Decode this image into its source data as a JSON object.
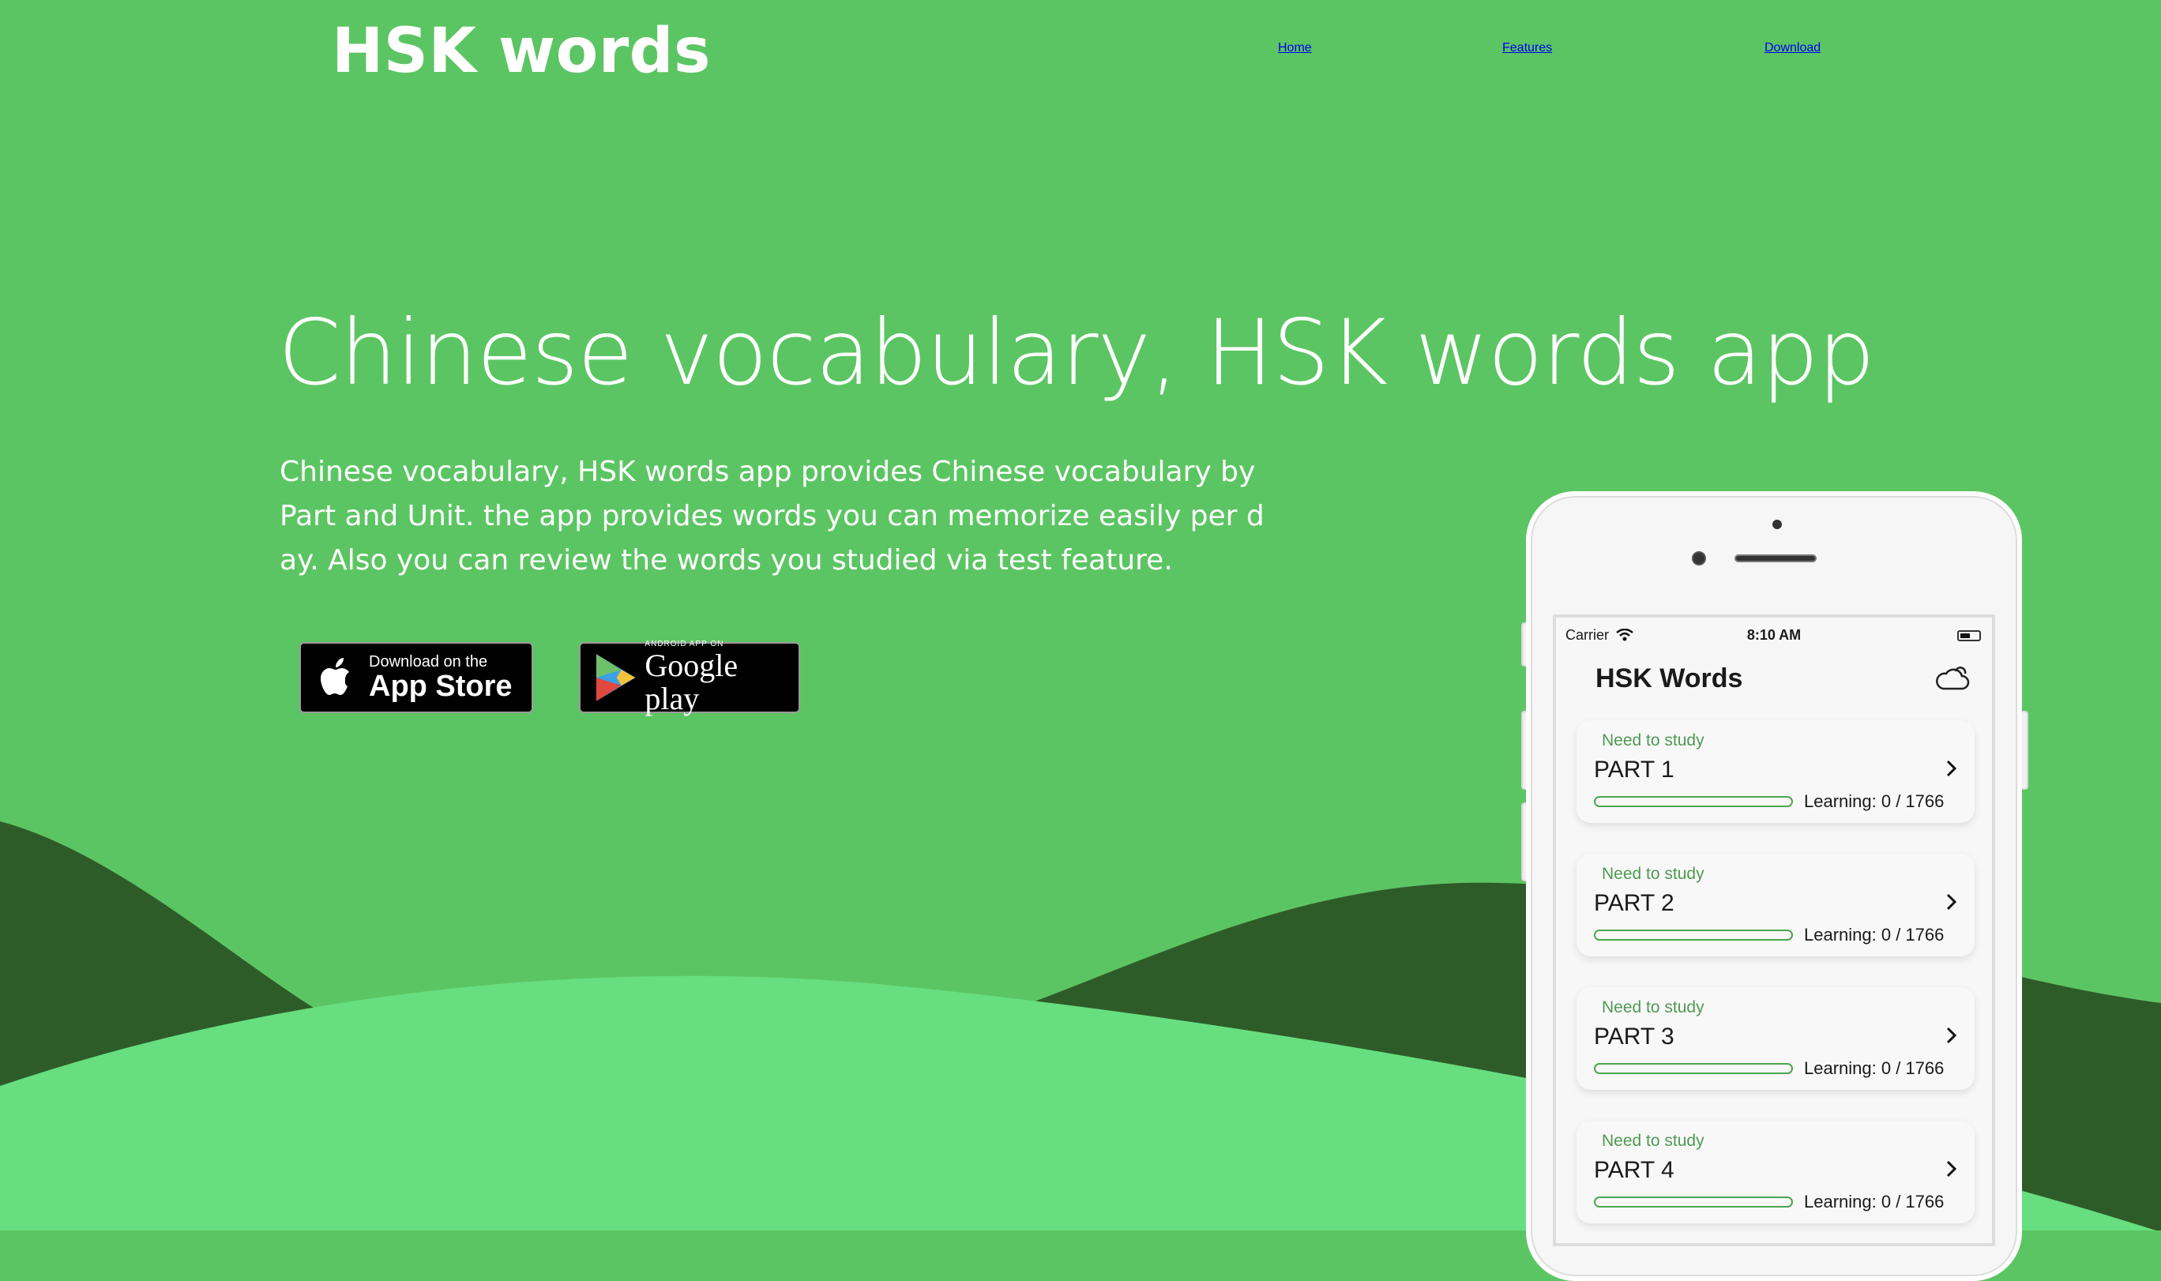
{
  "header": {
    "brand": "HSK words",
    "nav": [
      {
        "label": "Home"
      },
      {
        "label": "Features"
      },
      {
        "label": "Download"
      }
    ]
  },
  "hero": {
    "title": "Chinese vocabulary, HSK words app",
    "description": "Chinese vocabulary, HSK words app provides Chinese vocabulary by Part and Unit. the app provides words you can memorize easily per day. Also you can review the words you studied via test feature."
  },
  "badges": {
    "appstore": {
      "small": "Download on the",
      "big": "App Store"
    },
    "gplay": {
      "small": "ANDROID APP ON",
      "big": "Google play"
    }
  },
  "phone": {
    "status": {
      "carrier": "Carrier",
      "time": "8:10 AM"
    },
    "app_title": "HSK Words",
    "cards": [
      {
        "status": "Need to study",
        "part": "PART 1",
        "learning": "Learning: 0 / 1766",
        "progress": 0
      },
      {
        "status": "Need to study",
        "part": "PART 2",
        "learning": "Learning: 0 / 1766",
        "progress": 0
      },
      {
        "status": "Need to study",
        "part": "PART 3",
        "learning": "Learning: 0 / 1766",
        "progress": 0
      },
      {
        "status": "Need to study",
        "part": "PART 4",
        "learning": "Learning: 0 / 1766",
        "progress": 0
      }
    ]
  },
  "colors": {
    "background": "#5cc563",
    "wave_dark": "#2e5c28",
    "wave_light": "#67de80",
    "accent": "#4ca650"
  }
}
